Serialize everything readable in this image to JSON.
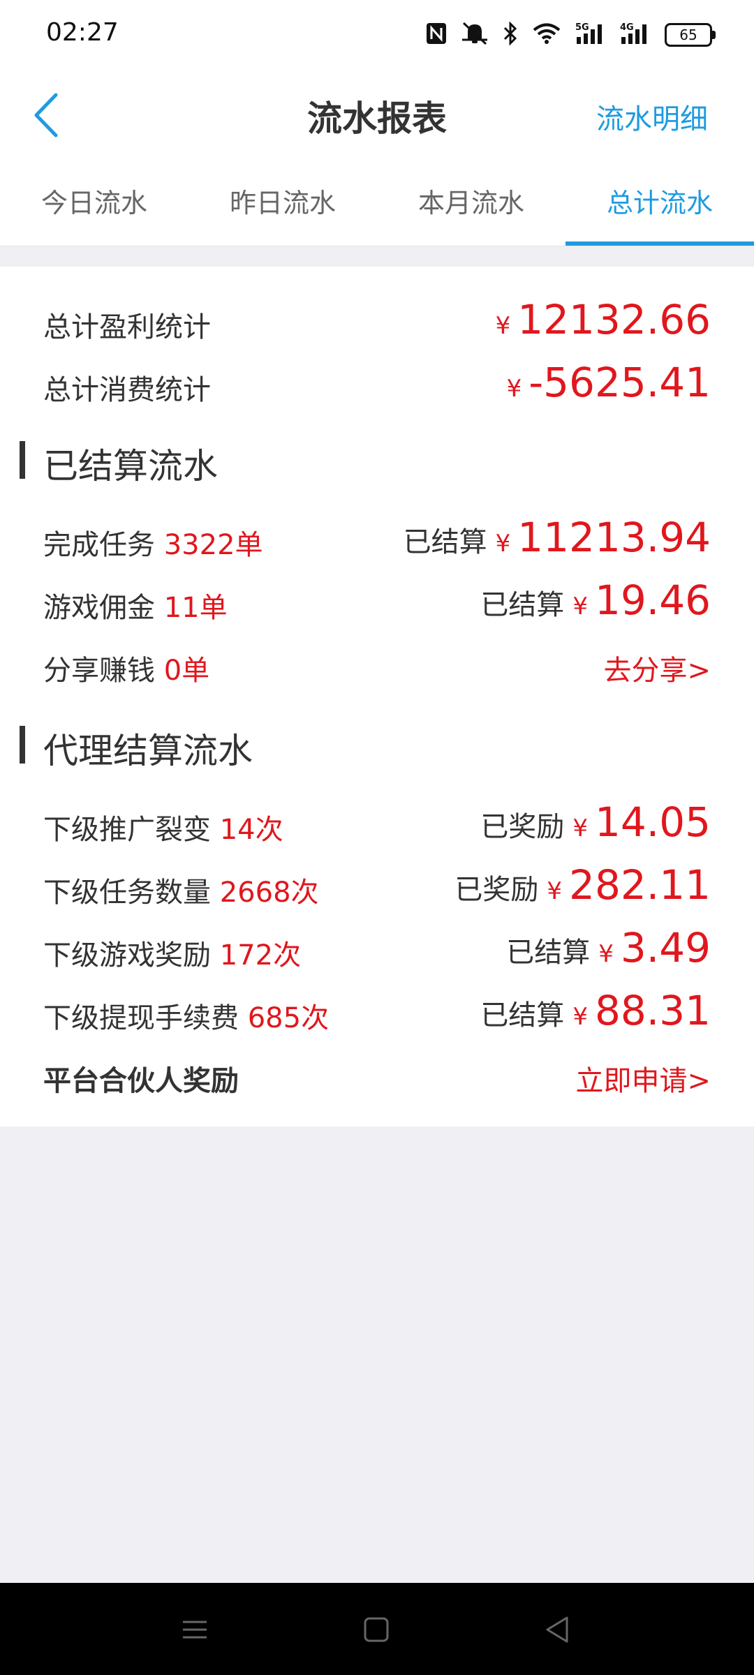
{
  "status_bar": {
    "time": "02:27",
    "battery": "65",
    "icons": [
      "nfc-icon",
      "mute-icon",
      "bluetooth-icon",
      "wifi-icon",
      "signal-5g-icon",
      "signal-4g-icon",
      "battery-icon"
    ]
  },
  "header": {
    "title": "流水报表",
    "detail_link": "流水明细"
  },
  "tabs": [
    {
      "label": "今日流水",
      "active": false
    },
    {
      "label": "昨日流水",
      "active": false
    },
    {
      "label": "本月流水",
      "active": false
    },
    {
      "label": "总计流水",
      "active": true
    }
  ],
  "summary": {
    "profit_label": "总计盈利统计",
    "profit_amount": "12132.66",
    "consume_label": "总计消费统计",
    "consume_amount": "-5625.41",
    "currency": "¥"
  },
  "settled": {
    "title": "已结算流水",
    "rows": [
      {
        "label": "完成任务",
        "count": "3322单",
        "status": "已结算",
        "amount": "11213.94"
      },
      {
        "label": "游戏佣金",
        "count": "11单",
        "status": "已结算",
        "amount": "19.46"
      },
      {
        "label": "分享赚钱",
        "count": "0单",
        "link": "去分享>"
      }
    ]
  },
  "agent": {
    "title": "代理结算流水",
    "rows": [
      {
        "label": "下级推广裂变",
        "count": "14次",
        "status": "已奖励",
        "amount": "14.05"
      },
      {
        "label": "下级任务数量",
        "count": "2668次",
        "status": "已奖励",
        "amount": "282.11"
      },
      {
        "label": "下级游戏奖励",
        "count": "172次",
        "status": "已结算",
        "amount": "3.49"
      },
      {
        "label": "下级提现手续费",
        "count": "685次",
        "status": "已结算",
        "amount": "88.31"
      },
      {
        "label": "平台合伙人奖励",
        "link": "立即申请>"
      }
    ]
  },
  "colors": {
    "accent": "#1e9be0",
    "money": "#e0171d",
    "background": "#efeff4"
  }
}
